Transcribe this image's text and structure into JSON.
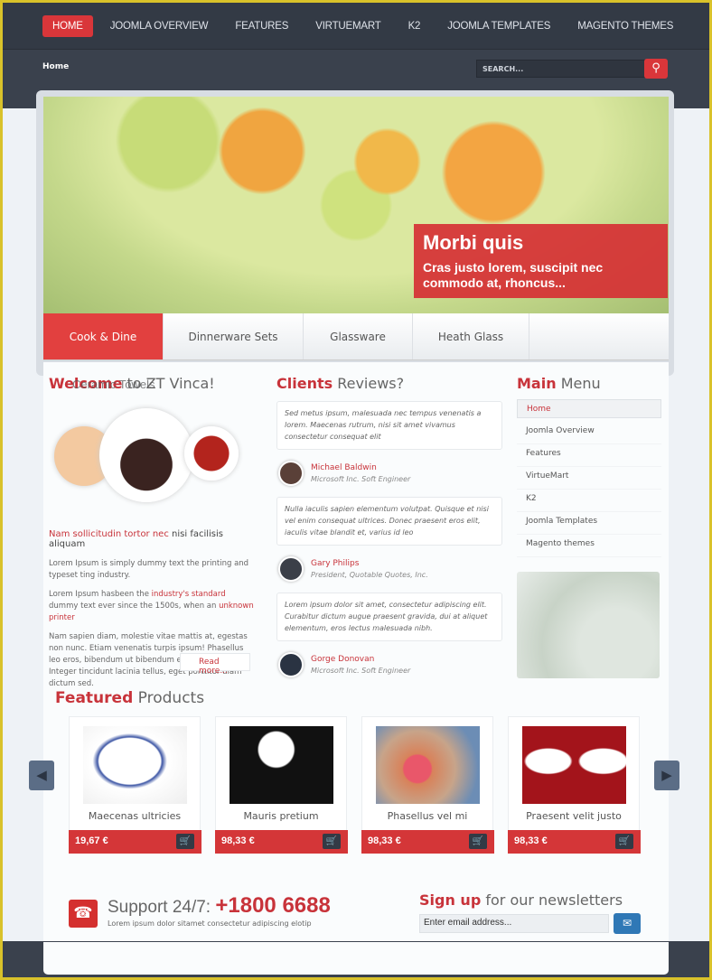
{
  "nav": {
    "items": [
      "HOME",
      "JOOMLA OVERVIEW",
      "FEATURES",
      "VIRTUEMART",
      "K2",
      "JOOMLA TEMPLATES",
      "MAGENTO THEMES"
    ],
    "active": 0
  },
  "breadcrumb": "Home",
  "search": {
    "placeholder": "SEARCH..."
  },
  "slider": {
    "title": "Morbi quis",
    "text": "Cras justo lorem, suscipit nec commodo at, rhoncus..."
  },
  "tabs": [
    "Cook & Dine",
    "Dinnerware Sets",
    "Glassware",
    "Heath Glass"
  ],
  "welcome": {
    "title_bold": "Welcome",
    "title_rest": "to ZT Vinca!",
    "overlay_text": "Ceramic Towels",
    "lead_red": "Nam sollicitudin tortor nec",
    "lead_rest": "nisi facilisis aliquam",
    "p1": "Lorem Ipsum is simply dummy text the printing and typeset ting industry.",
    "p2_a": "Lorem Ipsum hasbeen the ",
    "p2_link1": "industry's standard",
    "p2_b": " dummy text ever since the 1500s, when an ",
    "p2_link2": "unknown printer",
    "p3": "Nam sapien diam, molestie vitae mattis at, egestas non nunc. Etiam venenatis turpis ipsum! Phasellus leo eros, bibendum ut bibendum eu, viverra in risus. Integer tincidunt lacinia tellus, eget porttitor diam dictum sed.",
    "read_more": "Read more..."
  },
  "reviews": {
    "title_bold": "Clients",
    "title_rest": "Reviews?",
    "items": [
      {
        "quote": "Sed metus ipsum, malesuada nec tempus venenatis a lorem. Maecenas rutrum, nisi sit amet vivamus consectetur consequat elit",
        "name": "Michael Baldwin",
        "title": "Microsoft Inc. Soft Engineer"
      },
      {
        "quote": "Nulla iaculis sapien elementum volutpat. Quisque et nisi vel enim consequat ultrices. Donec praesent eros elit, iaculis vitae blandit et, varius id leo",
        "name": "Gary Philips",
        "title": "President, Quotable Quotes, Inc."
      },
      {
        "quote": "Lorem ipsum dolor sit amet, consectetur adipiscing elit. Curabitur dictum augue praesent gravida, dui at aliquet elementum, eros lectus malesuada nibh.",
        "name": "Gorge Donovan",
        "title": "Microsoft Inc. Soft Engineer"
      }
    ]
  },
  "main_menu": {
    "title_bold": "Main",
    "title_rest": "Menu",
    "items": [
      "Home",
      "Joomla Overview",
      "Features",
      "VirtueMart",
      "K2",
      "Joomla Templates",
      "Magento themes"
    ],
    "active": 0
  },
  "featured": {
    "title_bold": "Featured",
    "title_rest": "Products",
    "products": [
      {
        "name": "Maecenas ultricies",
        "price": "19,67 €"
      },
      {
        "name": "Mauris pretium",
        "price": "98,33 €"
      },
      {
        "name": "Phasellus vel mi",
        "price": "98,33 €"
      },
      {
        "name": "Praesent velit justo",
        "price": "98,33 €"
      }
    ]
  },
  "support": {
    "label": "Support 24/7:",
    "phone": "+1800 6688",
    "sub": "Lorem ipsum dolor sitamet consectetur adipiscing elotip"
  },
  "newsletter": {
    "title_bold": "Sign up",
    "title_rest": "for our newsletters",
    "value": "Enter email address..."
  },
  "colors": {
    "accent": "#d9363a",
    "header": "#333a45"
  }
}
